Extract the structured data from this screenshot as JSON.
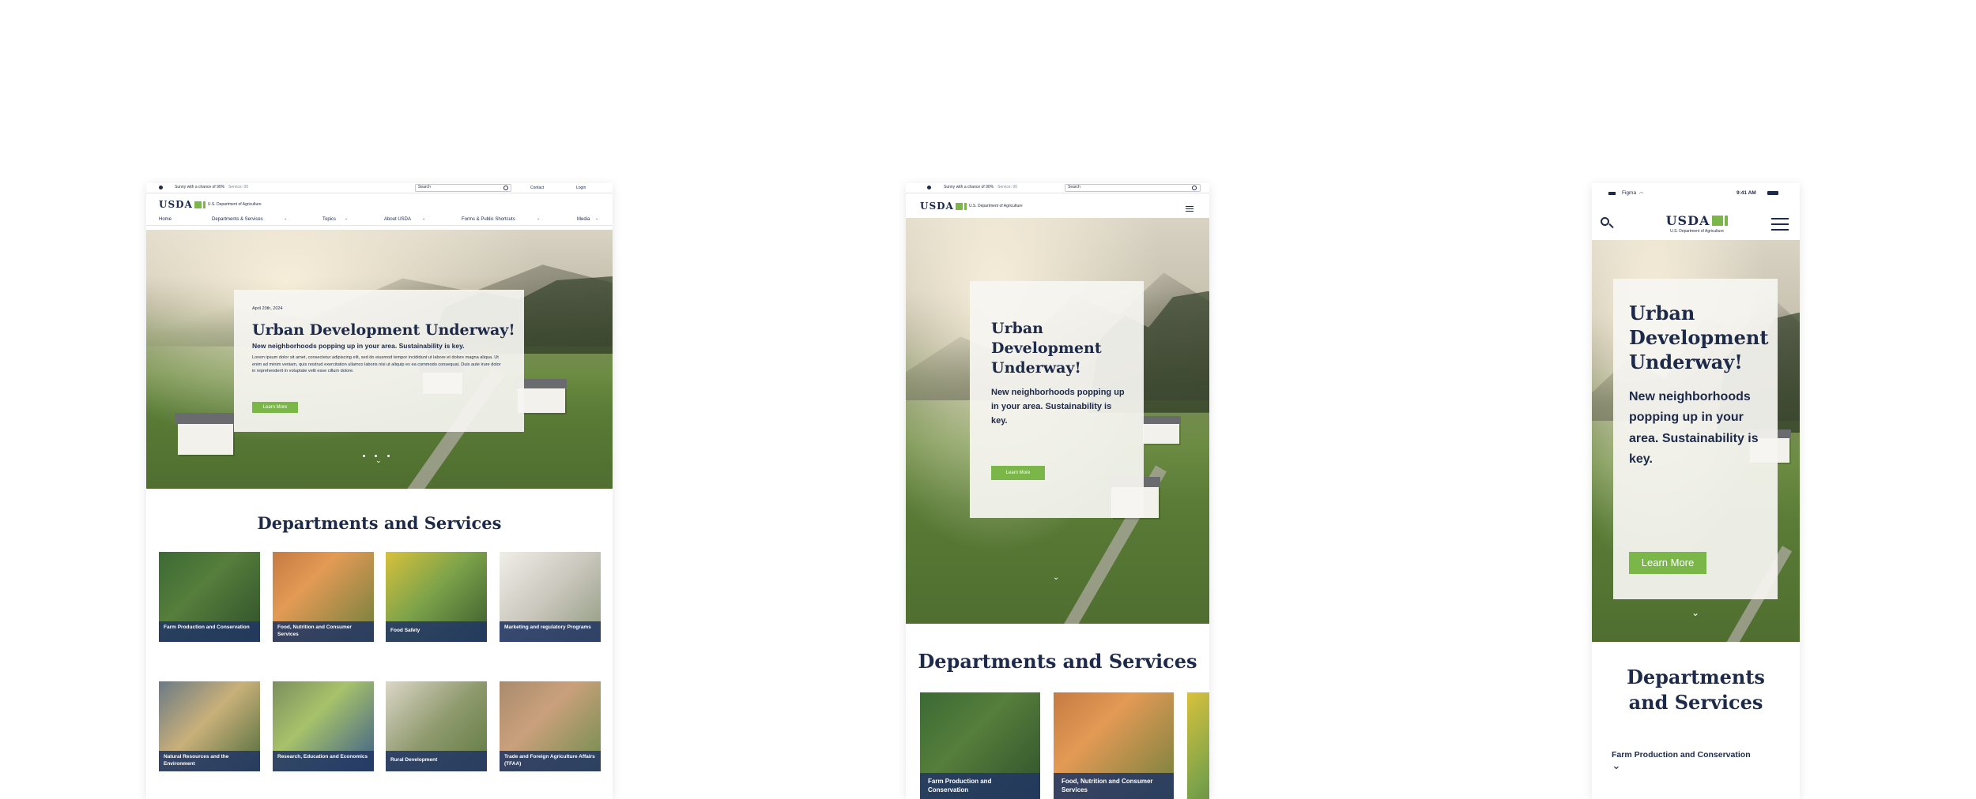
{
  "desktop": {
    "utility": {
      "weather": "Sunny with a chance of 90%",
      "weather_link": "Service: 00",
      "search_placeholder": "Search",
      "contact": "Contact",
      "login": "Login"
    },
    "logo": {
      "text": "USDA",
      "dept": "U.S. Department of Agriculture"
    },
    "nav": [
      "Home",
      "Departments & Services",
      "Topics",
      "About USDA",
      "Forms & Public Shortcuts",
      "Media"
    ],
    "hero": {
      "date": "April 20th, 2024",
      "title": "Urban Development Underway!",
      "subtitle": "New neighborhoods popping up in your area. Sustainability is key.",
      "body": "Lorem ipsum dolor sit amet, consectetur adipiscing elit, sed do eiusmod tempor incididunt ut labore et dolore magna aliqua. Ut enim ad minim veniam, quis nostrud exercitation ullamco laboris nisi ut aliquip ex ea commodo consequat. Duis aute irure dolor in reprehenderit in voluptate velit esse cillum dolore.",
      "cta": "Learn More"
    },
    "section_title": "Departments and Services",
    "departments": [
      "Farm Production and Conservation",
      "Food, Nutrition and Consumer Services",
      "Food Safety",
      "Marketing and regulatory Programs",
      "Natural Resources and the Environment",
      "Research, Education and Economics",
      "Rural Development",
      "Trade and Foreign Agriculture Affairs (TFAA)"
    ]
  },
  "tablet": {
    "weather": "Sunny with a chance of 90%",
    "weather_link": "Service: 00",
    "search_placeholder": "Search",
    "logo": {
      "text": "USDA",
      "dept": "U.S. Department of Agriculture"
    },
    "hero": {
      "title": "Urban Development Underway!",
      "subtitle": "New neighborhoods popping up in your area. Sustainability is key.",
      "cta": "Learn More"
    },
    "section_title": "Departments and Services",
    "departments": [
      "Farm Production and Conservation",
      "Food, Nutrition and Consumer Services"
    ]
  },
  "mobile": {
    "status": {
      "carrier": "Figma",
      "time": "9:41 AM"
    },
    "logo": {
      "text": "USDA",
      "dept": "U.S. Department of Agriculture"
    },
    "hero": {
      "title": "Urban Development Underway!",
      "subtitle": "New neighborhoods popping up in your area. Sustainability is key.",
      "cta": "Learn More"
    },
    "section_title": "Departments and Services",
    "accordion_item": "Farm Production and Conservation"
  },
  "colors": {
    "navy": "#1d2a4a",
    "green": "#7ab648",
    "label_blue": "#223763"
  }
}
